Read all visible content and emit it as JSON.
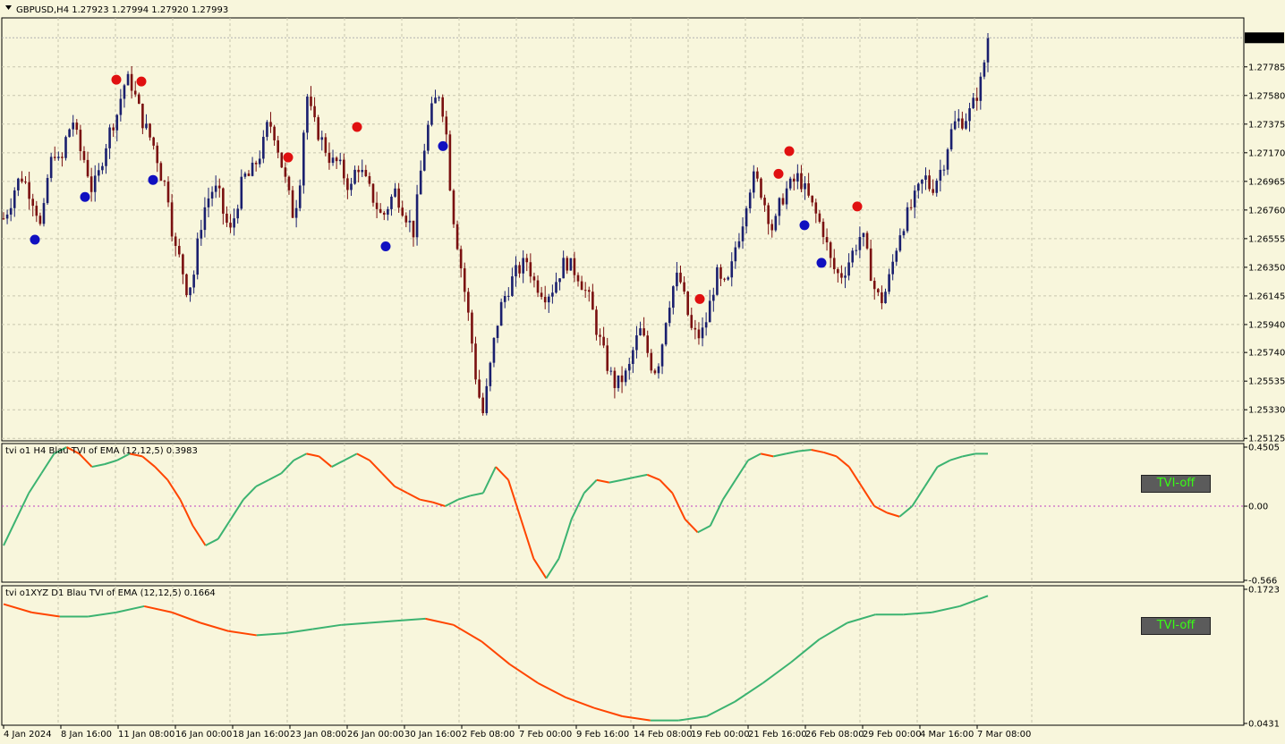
{
  "header": {
    "main_title": "GBPUSD,H4  1.27923 1.27994 1.27920 1.27993",
    "ind1_title": "tvi o1 H4 Blau TVI of EMA (12,12,5) 0.3983",
    "ind2_title": "tvi o1XYZ D1 Blau TVI of EMA (12,12,5) 0.1664"
  },
  "buttons": {
    "tvi_off_1": "TVI-off",
    "tvi_off_2": "TVI-off"
  },
  "colors": {
    "bg": "#f8f6dc",
    "grid": "#c8c6ae",
    "bull": "#1a1f6e",
    "bear": "#7a1010",
    "tvi_up": "#3cb371",
    "tvi_down": "#ff4500",
    "arrow_red": "#e01010",
    "arrow_blue": "#1010c0"
  },
  "chart_data": [
    {
      "type": "candlestick",
      "title": "GBPUSD,H4",
      "ohlc_last": {
        "open": 1.27923,
        "high": 1.27994,
        "low": 1.2792,
        "close": 1.27993
      },
      "current_price_label": "1.27993",
      "ylim": [
        1.2512,
        1.2811
      ],
      "y_ticks": [
        "1.27785",
        "1.27580",
        "1.27375",
        "1.27170",
        "1.26965",
        "1.26760",
        "1.26555",
        "1.26350",
        "1.26145",
        "1.25940",
        "1.25740",
        "1.25535",
        "1.25330",
        "1.25125"
      ],
      "x_ticks": [
        "4 Jan 2024",
        "8 Jan 16:00",
        "11 Jan 08:00",
        "16 Jan 00:00",
        "18 Jan 16:00",
        "23 Jan 08:00",
        "26 Jan 00:00",
        "30 Jan 16:00",
        "2 Feb 08:00",
        "7 Feb 00:00",
        "9 Feb 16:00",
        "14 Feb 08:00",
        "19 Feb 00:00",
        "21 Feb 16:00",
        "26 Feb 08:00",
        "29 Feb 00:00",
        "4 Mar 16:00",
        "7 Mar 08:00"
      ],
      "close_path": [
        1.267,
        1.268,
        1.2695,
        1.27,
        1.269,
        1.268,
        1.266,
        1.27,
        1.272,
        1.2705,
        1.273,
        1.274,
        1.272,
        1.271,
        1.269,
        1.27,
        1.272,
        1.2735,
        1.2745,
        1.2765,
        1.277,
        1.2755,
        1.274,
        1.273,
        1.272,
        1.27,
        1.269,
        1.265,
        1.264,
        1.262,
        1.2625,
        1.266,
        1.268,
        1.269,
        1.269,
        1.267,
        1.266,
        1.268,
        1.27,
        1.27,
        1.271,
        1.272,
        1.274,
        1.273,
        1.271,
        1.269,
        1.267,
        1.27,
        1.276,
        1.274,
        1.273,
        1.272,
        1.271,
        1.271,
        1.27,
        1.269,
        1.271,
        1.27,
        1.269,
        1.268,
        1.267,
        1.268,
        1.269,
        1.268,
        1.267,
        1.266,
        1.27,
        1.273,
        1.275,
        1.276,
        1.274,
        1.268,
        1.265,
        1.262,
        1.259,
        1.255,
        1.253,
        1.256,
        1.259,
        1.261,
        1.262,
        1.263,
        1.2635,
        1.264,
        1.2625,
        1.262,
        1.2615,
        1.262,
        1.263,
        1.264,
        1.2635,
        1.263,
        1.262,
        1.261,
        1.259,
        1.2575,
        1.256,
        1.255,
        1.2555,
        1.256,
        1.258,
        1.259,
        1.2575,
        1.256,
        1.257,
        1.26,
        1.262,
        1.263,
        1.261,
        1.259,
        1.2585,
        1.259,
        1.261,
        1.263,
        1.262,
        1.2625,
        1.265,
        1.2665,
        1.269,
        1.27,
        1.269,
        1.2675,
        1.266,
        1.268,
        1.269,
        1.2695,
        1.27,
        1.269,
        1.268,
        1.267,
        1.266,
        1.264,
        1.263,
        1.263,
        1.264,
        1.265,
        1.266,
        1.264,
        1.262,
        1.261,
        1.262,
        1.264,
        1.266,
        1.267,
        1.268,
        1.269,
        1.27,
        1.269,
        1.27,
        1.271,
        1.273,
        1.274,
        1.274,
        1.2745,
        1.2755,
        1.277,
        1.2799
      ],
      "annotations": [
        {
          "text": "fractal down arrow",
          "color": "red"
        },
        {
          "text": "fractal up arrow",
          "color": "blue"
        }
      ]
    },
    {
      "type": "line",
      "title": "tvi o1 H4 Blau TVI of EMA (12,12,5) 0.3983",
      "ylim": [
        -0.566,
        0.4505
      ],
      "y_ticks": [
        "0.4505",
        "0.00",
        "-0.566"
      ],
      "zero_line": true,
      "series": [
        {
          "name": "TVI of EMA (12,12,5)",
          "values": [
            -0.3,
            -0.1,
            0.1,
            0.25,
            0.4,
            0.45,
            0.4,
            0.3,
            0.32,
            0.35,
            0.4,
            0.38,
            0.3,
            0.2,
            0.05,
            -0.15,
            -0.3,
            -0.25,
            -0.1,
            0.05,
            0.15,
            0.2,
            0.25,
            0.35,
            0.4,
            0.38,
            0.3,
            0.35,
            0.4,
            0.35,
            0.25,
            0.15,
            0.1,
            0.05,
            0.03,
            0.0,
            0.05,
            0.08,
            0.1,
            0.3,
            0.2,
            -0.1,
            -0.4,
            -0.55,
            -0.4,
            -0.1,
            0.1,
            0.2,
            0.18,
            0.2,
            0.22,
            0.24,
            0.2,
            0.1,
            -0.1,
            -0.2,
            -0.15,
            0.05,
            0.2,
            0.35,
            0.4,
            0.38,
            0.4,
            0.42,
            0.43,
            0.41,
            0.38,
            0.3,
            0.15,
            0.0,
            -0.05,
            -0.08,
            0.0,
            0.15,
            0.3,
            0.35,
            0.38,
            0.4,
            0.4
          ]
        }
      ]
    },
    {
      "type": "line",
      "title": "tvi o1XYZ D1 Blau TVI of EMA (12,12,5) 0.1664",
      "ylim": [
        0.0431,
        0.1723
      ],
      "y_ticks": [
        "0.1723",
        "0.0431"
      ],
      "series": [
        {
          "name": "TVI of EMA (12,12,5)",
          "values": [
            0.158,
            0.15,
            0.146,
            0.146,
            0.15,
            0.156,
            0.15,
            0.14,
            0.132,
            0.128,
            0.13,
            0.134,
            0.138,
            0.14,
            0.142,
            0.144,
            0.138,
            0.122,
            0.1,
            0.082,
            0.068,
            0.058,
            0.05,
            0.046,
            0.046,
            0.05,
            0.064,
            0.082,
            0.102,
            0.124,
            0.14,
            0.148,
            0.148,
            0.15,
            0.156,
            0.166
          ]
        }
      ]
    }
  ]
}
